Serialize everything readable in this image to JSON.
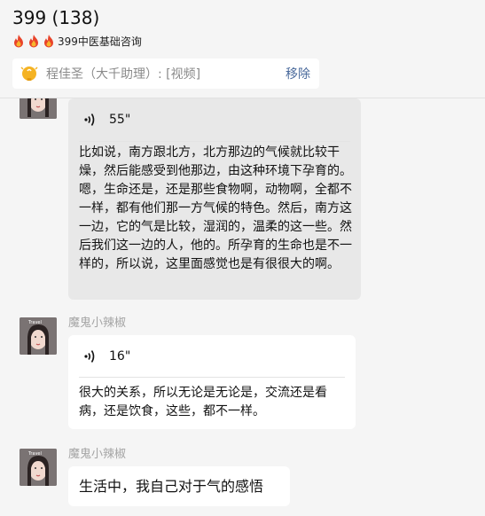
{
  "header": {
    "title": "399 (138)",
    "subtitle": "399中医基础咨询"
  },
  "notice": {
    "text": "程佳圣（大千助理）: [视频]",
    "remove_label": "移除"
  },
  "messages": [
    {
      "duration": "55\"",
      "transcript": "比如说，南方跟北方，北方那边的气候就比较干燥，然后能感受到他那边，由这种环境下孕育的。嗯，生命还是，还是那些食物啊，动物啊，全都不一样，都有他们那一方气候的特色。然后，南方这一边，它的气是比较，湿润的，温柔的这一些。然后我们这一边的人，他的。所孕育的生命也是不一样的，所以说，这里面感觉也是有很很大的啊。"
    },
    {
      "sender": "魔鬼小辣椒",
      "duration": "16\"",
      "transcript": "很大的关系，所以无论是无论是，交流还是看病，还是饮食，这些，都不一样。"
    },
    {
      "sender": "魔鬼小辣椒",
      "text": "生活中，我自己对于气的感悟"
    }
  ],
  "avatar_labels": [
    "Travel",
    "Travel"
  ],
  "colors": {
    "accent_link": "#4a6a9c",
    "grey_bubble": "#e8e8e8",
    "fire": "#e8432a"
  },
  "icons": [
    "fire-icon",
    "lightbulb-icon",
    "voice-wave-icon"
  ]
}
